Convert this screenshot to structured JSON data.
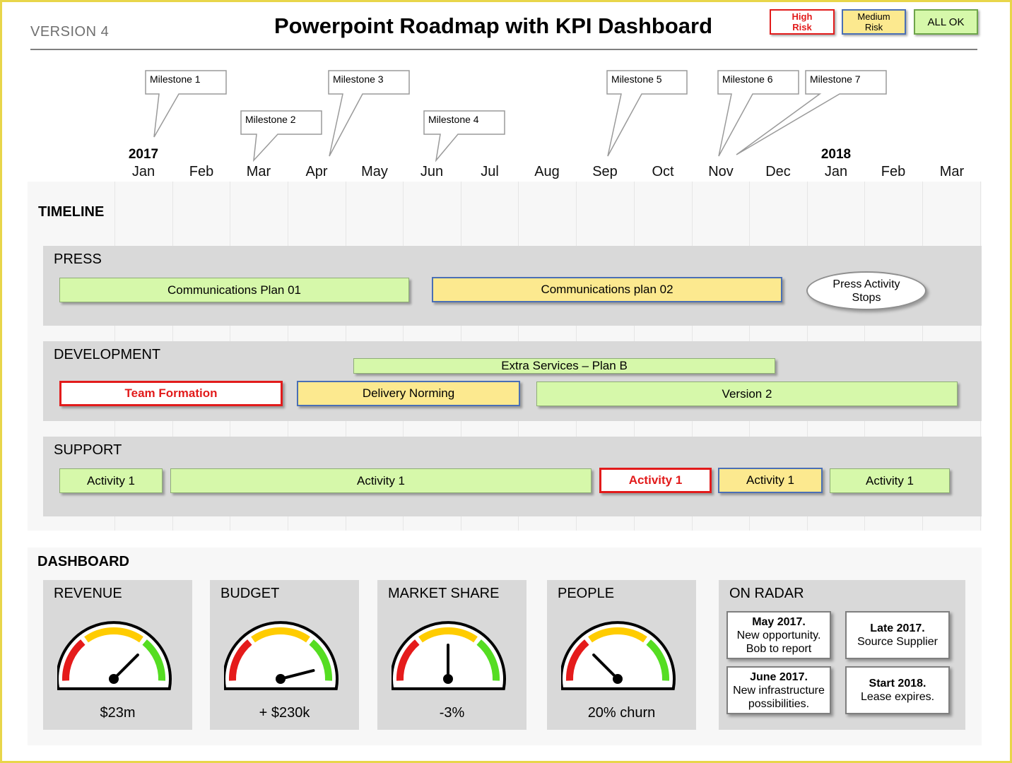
{
  "header": {
    "version": "VERSION 4",
    "title": "Powerpoint Roadmap with KPI Dashboard"
  },
  "legend": {
    "high": [
      "High",
      "Risk"
    ],
    "medium": [
      "Medium",
      "Risk"
    ],
    "ok": "ALL OK"
  },
  "timeline_axis": {
    "years": [
      "2017",
      "2018"
    ],
    "months": [
      "Jan",
      "Feb",
      "Mar",
      "Apr",
      "May",
      "Jun",
      "Jul",
      "Aug",
      "Sep",
      "Oct",
      "Nov",
      "Dec",
      "Jan",
      "Feb",
      "Mar"
    ]
  },
  "milestones": [
    "Milestone  1",
    "Milestone  2",
    "Milestone  3",
    "Milestone  4",
    "Milestone  5",
    "Milestone  6",
    "Milestone  7"
  ],
  "timeline": {
    "label": "TIMELINE",
    "press": {
      "label": "PRESS",
      "bars": [
        "Communications  Plan 01",
        "Communications  plan 02"
      ],
      "ellipse": [
        "Press Activity",
        "Stops"
      ]
    },
    "development": {
      "label": "DEVELOPMENT",
      "bars": [
        "Extra Services – Plan B",
        "Team Formation",
        "Delivery Norming",
        "Version  2"
      ]
    },
    "support": {
      "label": "SUPPORT",
      "bars": [
        "Activity  1",
        "Activity  1",
        "Activity 1",
        "Activity  1",
        "Activity  1"
      ]
    }
  },
  "dashboard": {
    "label": "DASHBOARD",
    "kpis": [
      {
        "title": "REVENUE",
        "value": "$23m",
        "needle_fraction": 0.75
      },
      {
        "title": "BUDGET",
        "value": "+ $230k",
        "needle_fraction": 0.92
      },
      {
        "title": "MARKET SHARE",
        "value": "-3%",
        "needle_fraction": 0.5
      },
      {
        "title": "PEOPLE",
        "value": "20% churn",
        "needle_fraction": 0.25
      }
    ],
    "gauge_colors": {
      "red": "#e51b1b",
      "yellow": "#ffcc00",
      "green": "#55dd22"
    },
    "radar": {
      "title": "ON RADAR",
      "items": [
        {
          "heading": "May 2017.",
          "lines": [
            "New opportunity.",
            "Bob to report"
          ]
        },
        {
          "heading": "Late 2017.",
          "lines": [
            "Source Supplier"
          ]
        },
        {
          "heading": "June 2017.",
          "lines": [
            "New infrastructure",
            "possibilities."
          ]
        },
        {
          "heading": "Start 2018.",
          "lines": [
            "Lease expires."
          ]
        }
      ]
    }
  },
  "colors": {
    "ok": "#d6f8aa",
    "medium": "#fce98f",
    "high": "#e21b1b",
    "band": "#d9d9d9",
    "frame": "#e8d64a"
  }
}
